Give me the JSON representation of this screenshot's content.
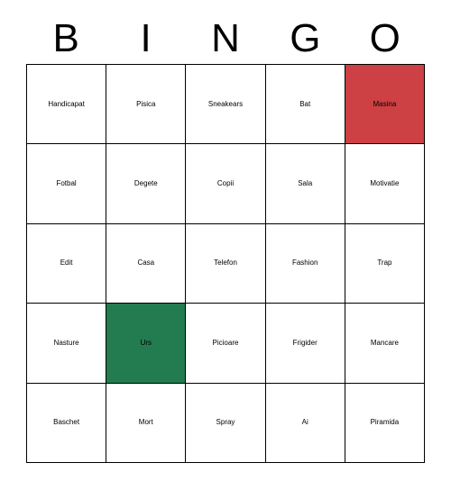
{
  "card": {
    "title": "BINGO",
    "header_letters": [
      "B",
      "I",
      "N",
      "G",
      "O"
    ],
    "colors": {
      "marked_red": "#cd4043",
      "marked_green": "#237c50",
      "cell_background": "#ffffff",
      "border": "#000000",
      "text": "#000000"
    },
    "grid": {
      "columns": 5,
      "rows": 5,
      "cells": [
        [
          {
            "label": "Handicapat",
            "mark": "none",
            "size": "xs"
          },
          {
            "label": "Pisica",
            "mark": "none",
            "size": "l"
          },
          {
            "label": "Sneakears",
            "mark": "none",
            "size": "s"
          },
          {
            "label": "Bat",
            "mark": "none",
            "size": "xxl"
          },
          {
            "label": "Masina",
            "mark": "red",
            "size": "m"
          }
        ],
        [
          {
            "label": "Fotbal",
            "mark": "none",
            "size": "l"
          },
          {
            "label": "Degete",
            "mark": "none",
            "size": "m"
          },
          {
            "label": "Copii",
            "mark": "none",
            "size": "xl"
          },
          {
            "label": "Sala",
            "mark": "none",
            "size": "xl"
          },
          {
            "label": "Motivatie",
            "mark": "none",
            "size": "s"
          }
        ],
        [
          {
            "label": "Edit",
            "mark": "none",
            "size": "xl"
          },
          {
            "label": "Casa",
            "mark": "none",
            "size": "xl"
          },
          {
            "label": "Telefon",
            "mark": "none",
            "size": "m"
          },
          {
            "label": "Fashion",
            "mark": "none",
            "size": "m"
          },
          {
            "label": "Trap",
            "mark": "none",
            "size": "xl"
          }
        ],
        [
          {
            "label": "Nasture",
            "mark": "none",
            "size": "m"
          },
          {
            "label": "Urs",
            "mark": "green",
            "size": "xxl"
          },
          {
            "label": "Picioare",
            "mark": "none",
            "size": "m"
          },
          {
            "label": "Frigider",
            "mark": "none",
            "size": "m"
          },
          {
            "label": "Mancare",
            "mark": "none",
            "size": "m"
          }
        ],
        [
          {
            "label": "Baschet",
            "mark": "none",
            "size": "s"
          },
          {
            "label": "Mort",
            "mark": "none",
            "size": "xl"
          },
          {
            "label": "Spray",
            "mark": "none",
            "size": "l"
          },
          {
            "label": "Ai",
            "mark": "none",
            "size": "xxl"
          },
          {
            "label": "Piramida",
            "mark": "none",
            "size": "s"
          }
        ]
      ]
    }
  }
}
